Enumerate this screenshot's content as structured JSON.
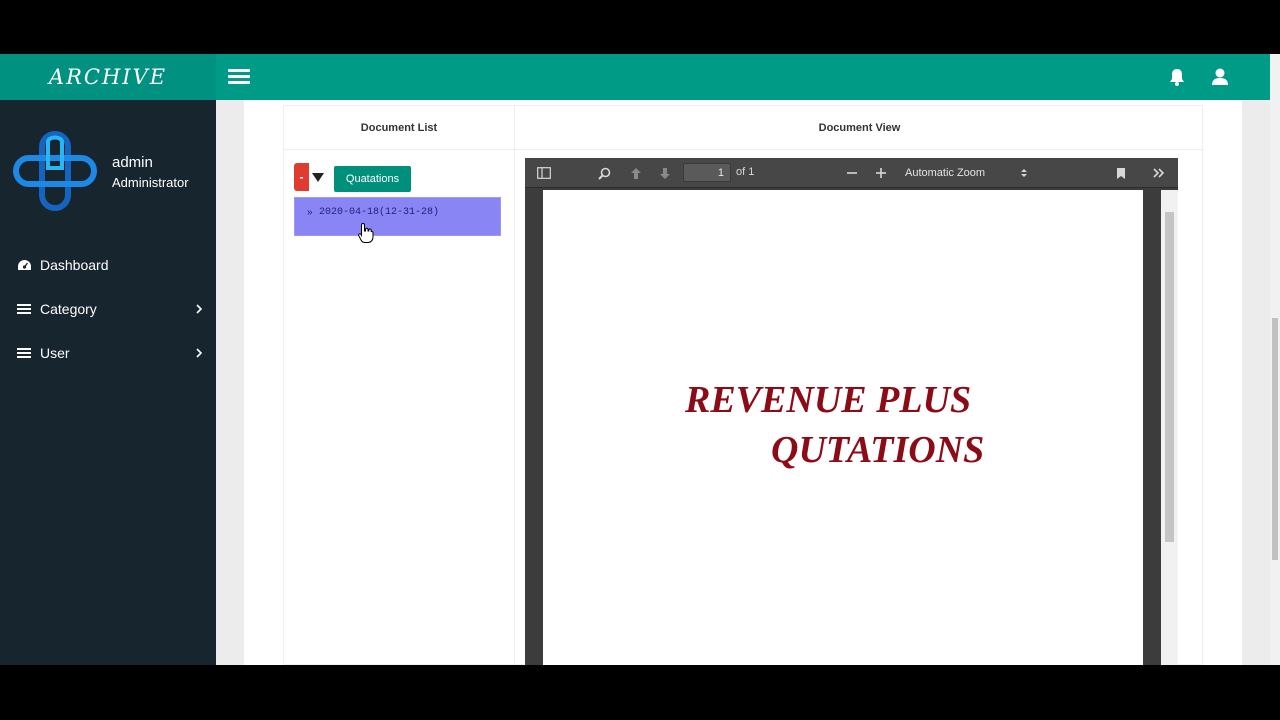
{
  "topbar": {
    "brand": "ARCHIVE",
    "menu_toggle_icon": "hamburger-icon",
    "notification_icon": "bell-icon",
    "profile_icon": "user-icon",
    "color": "#009b86"
  },
  "sidebar": {
    "user": {
      "name": "admin",
      "role": "Administrator"
    },
    "items": [
      {
        "label": "Dashboard",
        "icon": "dashboard-icon",
        "has_submenu": false
      },
      {
        "label": "Category",
        "icon": "list-icon",
        "has_submenu": true
      },
      {
        "label": "User",
        "icon": "list-icon",
        "has_submenu": true
      }
    ],
    "color": "#17252e"
  },
  "panels": {
    "document_list_title": "Document List",
    "document_view_title": "Document View"
  },
  "document_list": {
    "collapse_label": "-",
    "category_label": "Quatations",
    "documents": [
      {
        "bullet": "»",
        "name": "2020-04-18(12-31-28)"
      }
    ]
  },
  "pdf_viewer": {
    "current_page": "1",
    "page_count_label": "of 1",
    "zoom": "Automatic Zoom",
    "content": {
      "line1": "REVENUE PLUS",
      "line2": "QUTATIONS"
    },
    "title_color": "#8b0c17"
  }
}
